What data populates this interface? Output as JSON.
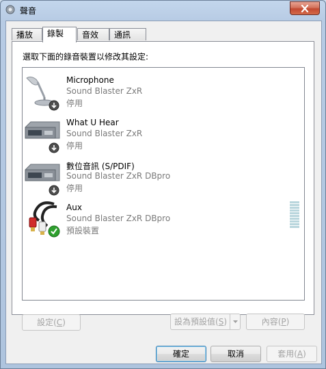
{
  "window": {
    "title": "聲音",
    "close_icon": "close-icon"
  },
  "tabs": [
    {
      "label": "播放",
      "active": false
    },
    {
      "label": "錄製",
      "active": true
    },
    {
      "label": "音效",
      "active": false
    },
    {
      "label": "通訊",
      "active": false
    }
  ],
  "instruction": "選取下面的錄音裝置以修改其設定:",
  "devices": [
    {
      "name": "Microphone",
      "product": "Sound Blaster ZxR",
      "status": "停用",
      "icon": "microphone-icon",
      "badge": "disabled-arrow-icon"
    },
    {
      "name": "What U Hear",
      "product": "Sound Blaster ZxR",
      "status": "停用",
      "icon": "sound-card-icon",
      "badge": "disabled-arrow-icon"
    },
    {
      "name": "數位音訊 (S/PDIF)",
      "product": "Sound Blaster ZxR DBpro",
      "status": "停用",
      "icon": "sound-card-icon",
      "badge": "disabled-arrow-icon"
    },
    {
      "name": "Aux",
      "product": "Sound Blaster ZxR DBpro",
      "status": "預設裝置",
      "icon": "rca-cable-icon",
      "badge": "default-check-icon",
      "level": 0
    }
  ],
  "buttons": {
    "configure": {
      "text": "設定(",
      "key": "C",
      "end": ")"
    },
    "set_default": {
      "text": "設為預設值(",
      "key": "S",
      "end": ")"
    },
    "properties": {
      "text": "內容(",
      "key": "P",
      "end": ")"
    },
    "ok": "確定",
    "cancel": "取消",
    "apply": {
      "text": "套用(",
      "key": "A",
      "end": ")"
    }
  },
  "colors": {
    "accent_check": "#2ea02e",
    "list_border": "#828790",
    "disabled_text": "#7a7a7a"
  }
}
